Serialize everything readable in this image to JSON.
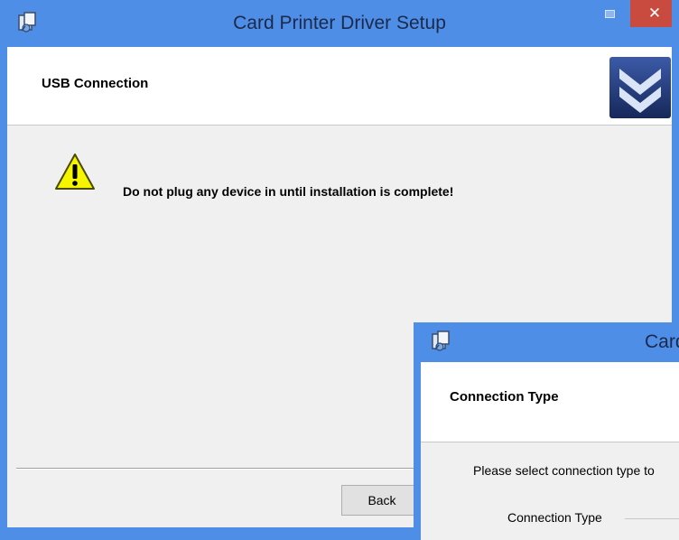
{
  "main_window": {
    "title": "Card Printer Driver Setup",
    "minimize_icon": "minimize-icon",
    "close_glyph": "✕",
    "header_title": "USB Connection",
    "warning_text": "Do not plug any device in until installation is complete!",
    "back_label": "Back",
    "colors": {
      "titlebar": "#4f8ee7",
      "close": "#c94b40",
      "warning": "#f5f500"
    }
  },
  "second_window": {
    "title_visible": "Card",
    "header_title": "Connection Type",
    "instruction": "Please select connection type to",
    "connection_type_label": "Connection Type"
  }
}
